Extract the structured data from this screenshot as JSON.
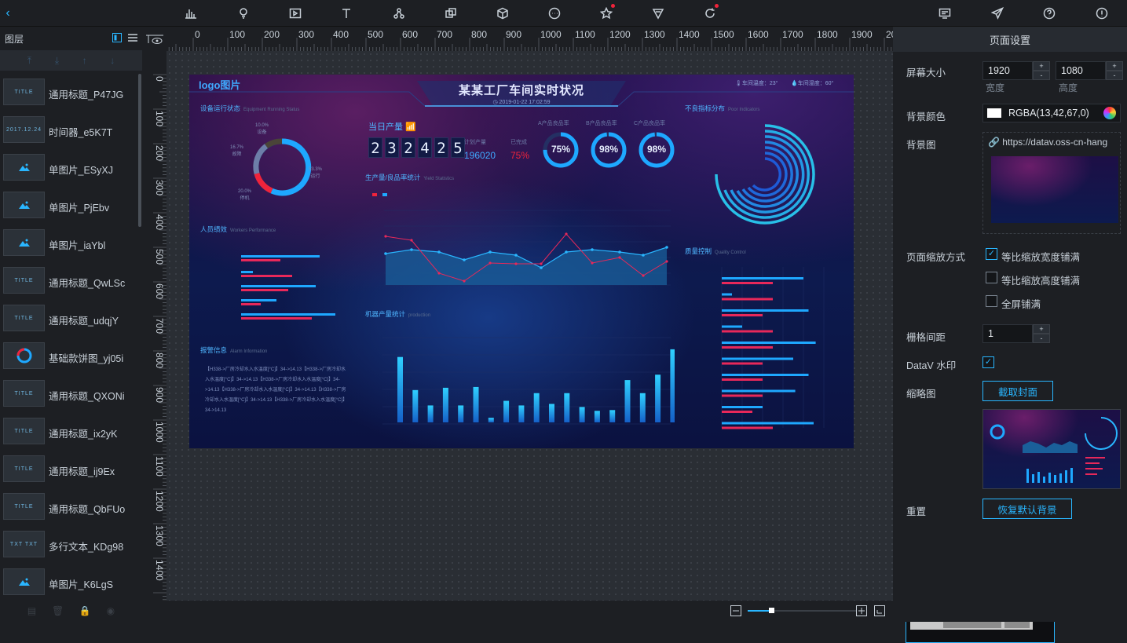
{
  "toolbar": {
    "icons": [
      "back-icon",
      "chart-icon",
      "map-icon",
      "media-icon",
      "text-icon",
      "network-icon",
      "material-icon",
      "3d-icon",
      "more-icon",
      "favorite-icon",
      "interaction-icon",
      "relation-icon",
      "monitor-icon",
      "publish-icon",
      "help-icon",
      "info-icon"
    ]
  },
  "layers": {
    "title": "图层",
    "items": [
      {
        "thumb": "TITLE",
        "label": "通用标题_P47JG"
      },
      {
        "thumb": "2017.12.24",
        "label": "时间器_e5K7T"
      },
      {
        "thumb": "",
        "label": "单图片_ESyXJ"
      },
      {
        "thumb": "",
        "label": "单图片_PjEbv"
      },
      {
        "thumb": "",
        "label": "单图片_iaYbl"
      },
      {
        "thumb": "TITLE",
        "label": "通用标题_QwLSc"
      },
      {
        "thumb": "TITLE",
        "label": "通用标题_udqjY"
      },
      {
        "thumb": "",
        "label": "基础款饼图_yj05i"
      },
      {
        "thumb": "TITLE",
        "label": "通用标题_QXONi"
      },
      {
        "thumb": "TITLE",
        "label": "通用标题_ix2yK"
      },
      {
        "thumb": "TITLE",
        "label": "通用标题_ij9Ex"
      },
      {
        "thumb": "TITLE",
        "label": "通用标题_QbFUo"
      },
      {
        "thumb": "TXT TXT",
        "label": "多行文本_KDg98"
      },
      {
        "thumb": "",
        "label": "单图片_K6LgS"
      }
    ]
  },
  "rulers": {
    "h": [
      "0",
      "100",
      "200",
      "300",
      "400",
      "500",
      "600",
      "700",
      "800",
      "900",
      "1000",
      "1100",
      "1200",
      "1300",
      "1400",
      "1500",
      "1600",
      "1700",
      "1800",
      "1900",
      "20"
    ],
    "v": [
      "0",
      "100",
      "200",
      "300",
      "400",
      "500",
      "600",
      "700",
      "800",
      "900",
      "1000",
      "1100",
      "1200",
      "1300",
      "1400"
    ]
  },
  "screen": {
    "logo": "logo图片",
    "title": "某某工厂车间实时状况",
    "datetime": "2019-01-22 17:02:59",
    "temp": "车间温度：23°",
    "humidity": "车间湿度：60°",
    "equipment_title": "设备运行状态",
    "equipment_sub": "Equipment Running Status",
    "pie": [
      {
        "label": "设备",
        "value": "10.0%"
      },
      {
        "label": "故障",
        "value": "16.7%"
      },
      {
        "label": "运行",
        "value": "53.3%"
      },
      {
        "label": "停机",
        "value": "20.0%"
      }
    ],
    "today_title": "当日产量",
    "digits": [
      "2",
      "3",
      "2",
      "4",
      "2",
      "5"
    ],
    "plan_label": "计划产量",
    "plan_value": "196020",
    "done_label": "已完成",
    "done_value": "75%",
    "rates": [
      {
        "label": "A产品良品率",
        "value": "75%"
      },
      {
        "label": "B产品良品率",
        "value": "98%"
      },
      {
        "label": "C产品良品率",
        "value": "98%"
      }
    ],
    "yield_title": "生产量/良品率统计",
    "yield_sub": "Yield Statistics",
    "defect_title": "不良指标分布",
    "defect_sub": "Poor Indicators",
    "workers_title": "人员绩效",
    "workers_sub": "Workers Performance",
    "alarm_title": "报警信息",
    "alarm_sub": "Alarm Information",
    "alarm_text": "【H338->厂房冷却水入水温度[°C]】34->14.13【H338->厂房冷却水入水温度[°C]】34->14.13【H338->厂房冷却水入水温度[°C]】34->14.13【H338->厂房冷却水入水温度[°C]】34->14.13【H338->厂房冷却水入水温度[°C]】34->14.13【H338->厂房冷却水入水温度[°C]】34->14.13",
    "production_title": "机器产量统计",
    "production_sub": "production",
    "quality_title": "质量控制",
    "quality_sub": "Quality Control"
  },
  "page_settings": {
    "title": "页面设置",
    "screen_size_label": "屏幕大小",
    "width_value": "1920",
    "height_value": "1080",
    "width_label": "宽度",
    "height_label": "高度",
    "bg_color_label": "背景颜色",
    "bg_color_value": "RGBA(13,42,67,0)",
    "bg_image_label": "背景图",
    "bg_image_url": "https://datav.oss-cn-hang",
    "scale_label": "页面缩放方式",
    "scale_options": [
      {
        "label": "等比缩放宽度铺满",
        "checked": true
      },
      {
        "label": "等比缩放高度铺满",
        "checked": false
      },
      {
        "label": "全屏铺满",
        "checked": false
      }
    ],
    "grid_label": "栅格间距",
    "grid_value": "1",
    "watermark_label": "DataV 水印",
    "thumbnail_label": "缩略图",
    "capture_button": "截取封面",
    "reset_label": "重置",
    "reset_button": "恢复默认背景"
  },
  "colors": {
    "accent": "#29b6ff",
    "red": "#f0233b",
    "panel": "#1d1f23",
    "canvas": "#2a2e34"
  }
}
